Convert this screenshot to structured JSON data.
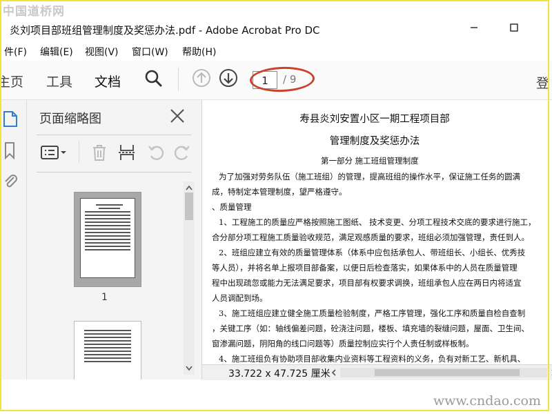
{
  "watermark": {
    "top": "中国道桥网",
    "bottom": "www.cndao.com"
  },
  "window": {
    "title": "炎刘项目部班组管理制度及奖惩办法.pdf - Adobe Acrobat Pro DC"
  },
  "menu": {
    "items": [
      "件(F)",
      "编辑(E)",
      "视图(V)",
      "窗口(W)",
      "帮助(H)"
    ]
  },
  "toolbar": {
    "tabs": [
      "主页",
      "工具",
      "文档"
    ],
    "active_tab": "文档",
    "current_page": "1",
    "total_pages": "/ 9",
    "signin": "登"
  },
  "rail": {
    "icons": [
      "page-thumbnails-icon",
      "bookmark-icon",
      "attachment-icon"
    ]
  },
  "thumbnail_panel": {
    "title": "页面缩略图",
    "page_label": "1"
  },
  "document": {
    "heading1": "寿县炎刘安置小区一期工程项目部",
    "heading2": "管理制度及奖惩办法",
    "lines": [
      "第一部分    施工班组管理制度",
      "为了加强对劳务队伍（施工班组）的管理，提高班组的操作水平，保证施工任务的圆满",
      "成，特制定本管理制度，望严格遵守。",
      "、质量管理",
      "1、工程施工的质量应严格按照施工图纸、   技术变更、分项工程技术交底的要求进行施工，",
      "合分部分项工程施工质量验收规范，满足观感质量的要求，班组必须加强管理，责任到人。",
      "2、班组应建立有效的质量管理体系（体系中应包括承包人、带班组长、小组长、优秀技",
      "等人员），并将名单上报项目部备案，以便日后检查落实，如果体系中的人员在质量管理",
      "程中出现疏忽或能力无法满足要求，项目部有权要求调换，班组承包人应在两日内将适宜",
      "人员调配到场。",
      "3、施工班组应建立健全施工质量检验制度，严格工序管理，强化工序和质量自检自查制",
      "，关键工序（如：轴线偏差问题，砼浇注问题，楼板、填充墙的裂缝问题，屋面、卫生间、",
      "窗渗漏问题，阴阳角的线口问题等）质量控制应实行个人责任制或样板制。",
      "4、施工班组负有协助项目部收集内业资料等工程资料的义务，负有对新工艺、新机具、"
    ]
  },
  "status": {
    "page_size": "33.722 x 47.725 厘米"
  },
  "colors": {
    "frame": "#f2e23c",
    "highlight_ellipse": "#c9432c"
  }
}
